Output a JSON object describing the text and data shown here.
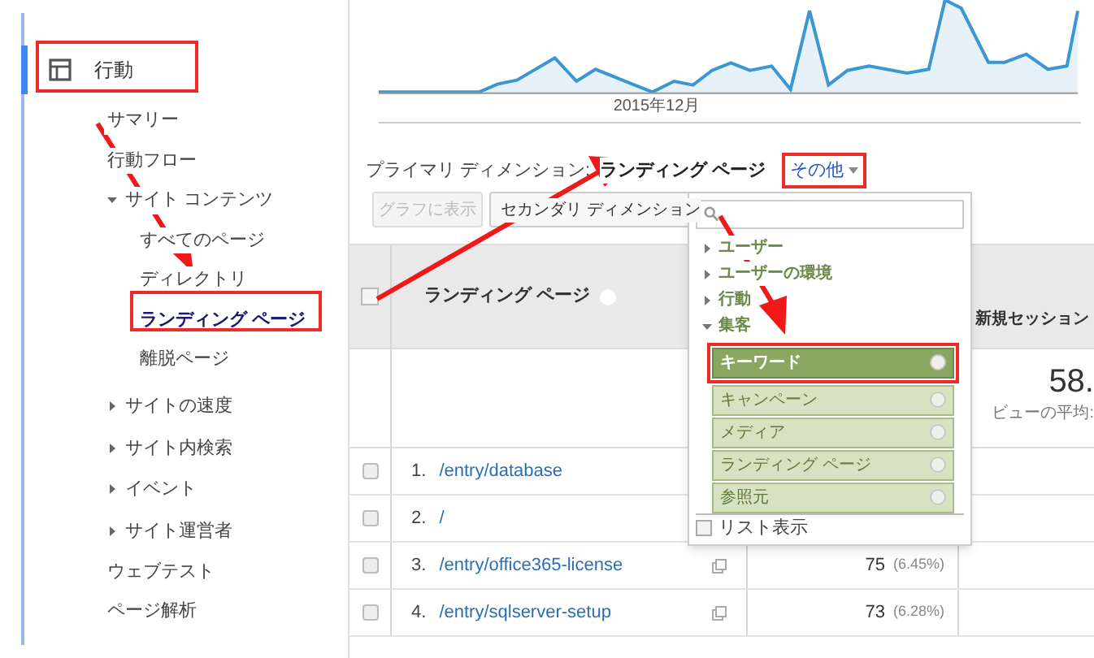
{
  "sidebar": {
    "section": {
      "label": "行動",
      "active": true
    },
    "items": [
      {
        "label": "サマリー",
        "kind": "page",
        "selected": false
      },
      {
        "label": "行動フロー",
        "kind": "page",
        "selected": false
      },
      {
        "label": "サイト コンテンツ",
        "kind": "folder",
        "expanded": true,
        "selected": false,
        "children": [
          {
            "label": "すべてのページ",
            "kind": "page",
            "selected": false
          },
          {
            "label": "ディレクトリ",
            "kind": "page",
            "selected": false
          },
          {
            "label": "ランディング ページ",
            "kind": "page",
            "selected": true
          },
          {
            "label": "離脱ページ",
            "kind": "page",
            "selected": false
          }
        ]
      },
      {
        "label": "サイトの速度",
        "kind": "folder",
        "expanded": false,
        "selected": false
      },
      {
        "label": "サイト内検索",
        "kind": "folder",
        "expanded": false,
        "selected": false
      },
      {
        "label": "イベント",
        "kind": "folder",
        "expanded": false,
        "selected": false
      },
      {
        "label": "サイト運営者",
        "kind": "folder",
        "expanded": false,
        "selected": false
      },
      {
        "label": "ウェブテスト",
        "kind": "page",
        "selected": false
      },
      {
        "label": "ページ解析",
        "kind": "page",
        "selected": false
      }
    ]
  },
  "chart": {
    "x_label": "2015年12月"
  },
  "primary_dimension": {
    "label": "プライマリ ディメンション:",
    "value": "ランディング ページ",
    "other": "その他"
  },
  "toolbar": {
    "plot_button": {
      "label": "グラフに表示",
      "disabled": true
    },
    "secondary_dimension": {
      "label": "セカンダリ ディメンション"
    }
  },
  "dimension_menu": {
    "groups": [
      {
        "label": "ユーザー",
        "expanded": false
      },
      {
        "label": "ユーザーの環境",
        "expanded": false
      },
      {
        "label": "行動",
        "expanded": false
      },
      {
        "label": "集客",
        "expanded": true,
        "children": [
          {
            "label": "キーワード",
            "selected": true
          },
          {
            "label": "キャンペーン",
            "selected": false
          },
          {
            "label": "メディア",
            "selected": false
          },
          {
            "label": "ランディング ページ",
            "selected": false
          },
          {
            "label": "参照元",
            "selected": false
          }
        ]
      }
    ],
    "list_view": {
      "label": "リスト表示",
      "checked": false
    }
  },
  "table": {
    "columns": [
      {
        "label": "ランディング ページ"
      },
      {
        "label": "新規セッション"
      }
    ],
    "select_all": {
      "checked": false
    },
    "summary": {
      "value": "58.",
      "caption": "ビューの平均:"
    },
    "rows": [
      {
        "index": "1.",
        "page": "/entry/database",
        "checked": false
      },
      {
        "index": "2.",
        "page": "/",
        "checked": false
      },
      {
        "index": "3.",
        "page": "/entry/office365-license",
        "checked": false,
        "sessions": "75",
        "share": "(6.45%)"
      },
      {
        "index": "4.",
        "page": "/entry/sqlserver-setup",
        "checked": false,
        "sessions": "73",
        "share": "(6.28%)"
      }
    ]
  }
}
